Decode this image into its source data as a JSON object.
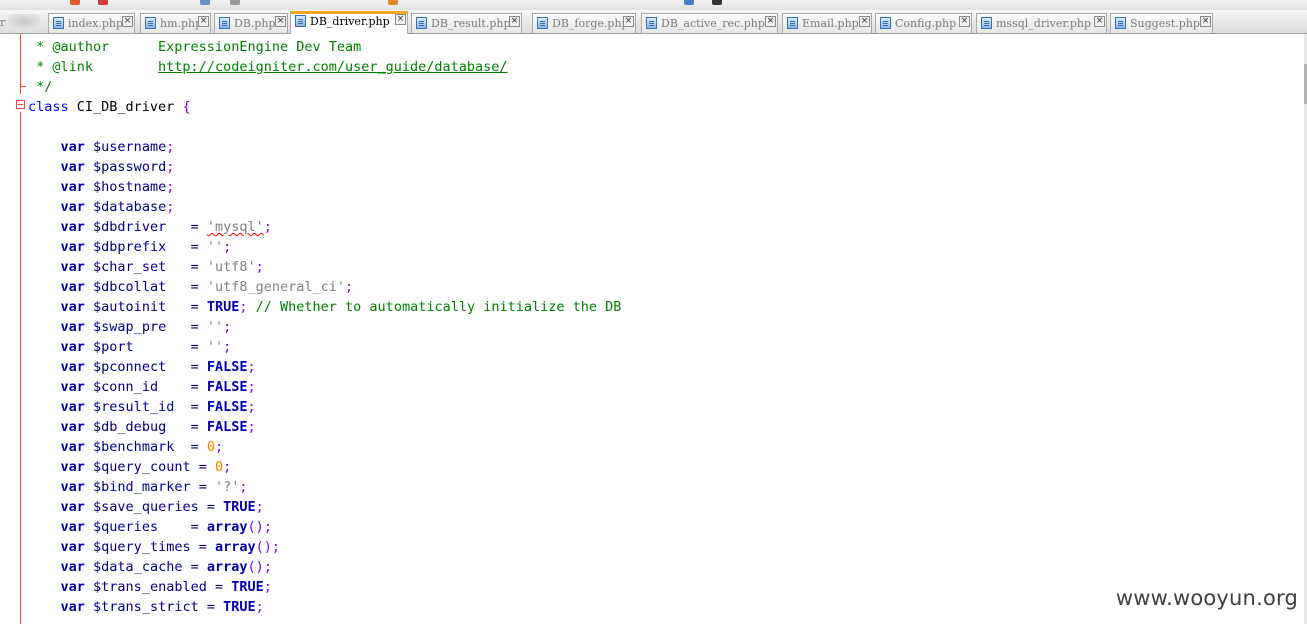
{
  "toolbar": {
    "glyph_colors": [
      "#e05a2b",
      "#d13c3c",
      "#6b8fc7",
      "#9a9a9a",
      "#e08a2b",
      "#4a7fd0",
      "#333333"
    ]
  },
  "tabs": [
    {
      "label": "index.php",
      "active": false
    },
    {
      "label": "hm.php",
      "active": false
    },
    {
      "label": "DB.php",
      "active": false
    },
    {
      "label": "DB_driver.php",
      "active": true
    },
    {
      "label": "DB_result.php",
      "active": false
    },
    {
      "label": "DB_forge.php",
      "active": false
    },
    {
      "label": "DB_active_rec.php",
      "active": false
    },
    {
      "label": "Email.php",
      "active": false
    },
    {
      "label": "Config.php",
      "active": false
    },
    {
      "label": "mssql_driver.php",
      "active": false
    },
    {
      "label": "Suggest.php",
      "active": false
    }
  ],
  "tab_partial_label": "r",
  "colors": {
    "active_tab_accent": "#f5a623",
    "comment": "#008000",
    "keyword": "#0000ff",
    "string": "#808080",
    "number": "#ff8000",
    "fold_marker": "#ff3b3b"
  },
  "code": {
    "lines": [
      {
        "kind": "comment",
        "text": " * @author      ExpressionEngine Dev Team"
      },
      {
        "kind": "comment-link",
        "prefix": " * @link        ",
        "link": "http://codeigniter.com/user_guide/database/"
      },
      {
        "kind": "comment",
        "text": " */"
      },
      {
        "kind": "class",
        "keyword": "class",
        "name": " CI_DB_driver ",
        "brace": "{"
      },
      {
        "kind": "blank"
      },
      {
        "kind": "decl",
        "var": "$username",
        "pad": ""
      },
      {
        "kind": "decl",
        "var": "$password",
        "pad": ""
      },
      {
        "kind": "decl",
        "var": "$hostname",
        "pad": ""
      },
      {
        "kind": "decl",
        "var": "$database",
        "pad": ""
      },
      {
        "kind": "assign",
        "var": "$dbdriver",
        "valkind": "string",
        "value": "'mysql'"
      },
      {
        "kind": "assign",
        "var": "$dbprefix",
        "valkind": "string",
        "value": "''"
      },
      {
        "kind": "assign",
        "var": "$char_set",
        "valkind": "string",
        "value": "'utf8'"
      },
      {
        "kind": "assign",
        "var": "$dbcollat",
        "valkind": "string",
        "value": "'utf8_general_ci'"
      },
      {
        "kind": "assign",
        "var": "$autoinit",
        "valkind": "const",
        "value": "TRUE",
        "comment": " // Whether to automatically initialize the DB"
      },
      {
        "kind": "assign",
        "var": "$swap_pre",
        "valkind": "string",
        "value": "''"
      },
      {
        "kind": "assign",
        "var": "$port",
        "valkind": "string",
        "value": "''"
      },
      {
        "kind": "assign",
        "var": "$pconnect",
        "valkind": "const",
        "value": "FALSE"
      },
      {
        "kind": "assign",
        "var": "$conn_id",
        "valkind": "const",
        "value": "FALSE"
      },
      {
        "kind": "assign",
        "var": "$result_id",
        "valkind": "const",
        "value": "FALSE"
      },
      {
        "kind": "assign",
        "var": "$db_debug",
        "valkind": "const",
        "value": "FALSE"
      },
      {
        "kind": "assign",
        "var": "$benchmark",
        "valkind": "number",
        "value": "0"
      },
      {
        "kind": "assign",
        "var": "$query_count",
        "valkind": "number",
        "value": "0"
      },
      {
        "kind": "assign",
        "var": "$bind_marker",
        "valkind": "string",
        "value": "'?'"
      },
      {
        "kind": "assign",
        "var": "$save_queries",
        "valkind": "const",
        "value": "TRUE"
      },
      {
        "kind": "assign",
        "var": "$queries",
        "valkind": "call",
        "value": "array"
      },
      {
        "kind": "assign",
        "var": "$query_times",
        "valkind": "call",
        "value": "array"
      },
      {
        "kind": "assign",
        "var": "$data_cache",
        "valkind": "call",
        "value": "array"
      },
      {
        "kind": "assign",
        "var": "$trans_enabled",
        "valkind": "const",
        "value": "TRUE"
      },
      {
        "kind": "assign",
        "var": "$trans_strict",
        "valkind": "const",
        "value": "TRUE"
      }
    ]
  },
  "watermark": "www.wooyun.org"
}
